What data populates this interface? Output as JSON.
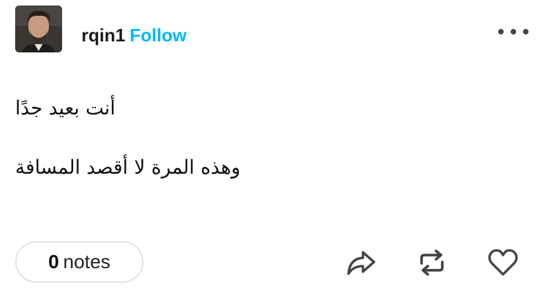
{
  "post": {
    "username": "rqin1",
    "follow_label": "Follow",
    "text_lines": [
      "أنت بعيد جدًا",
      "وهذه المرة لا أقصد المسافة"
    ]
  },
  "footer": {
    "notes_count": "0",
    "notes_label": "notes"
  },
  "icons": {
    "more": "more-horizontal-icon",
    "share": "share-arrow-icon",
    "reblog": "reblog-icon",
    "like": "heart-icon"
  },
  "colors": {
    "follow_accent": "#00b8ff",
    "icon": "#444444"
  }
}
